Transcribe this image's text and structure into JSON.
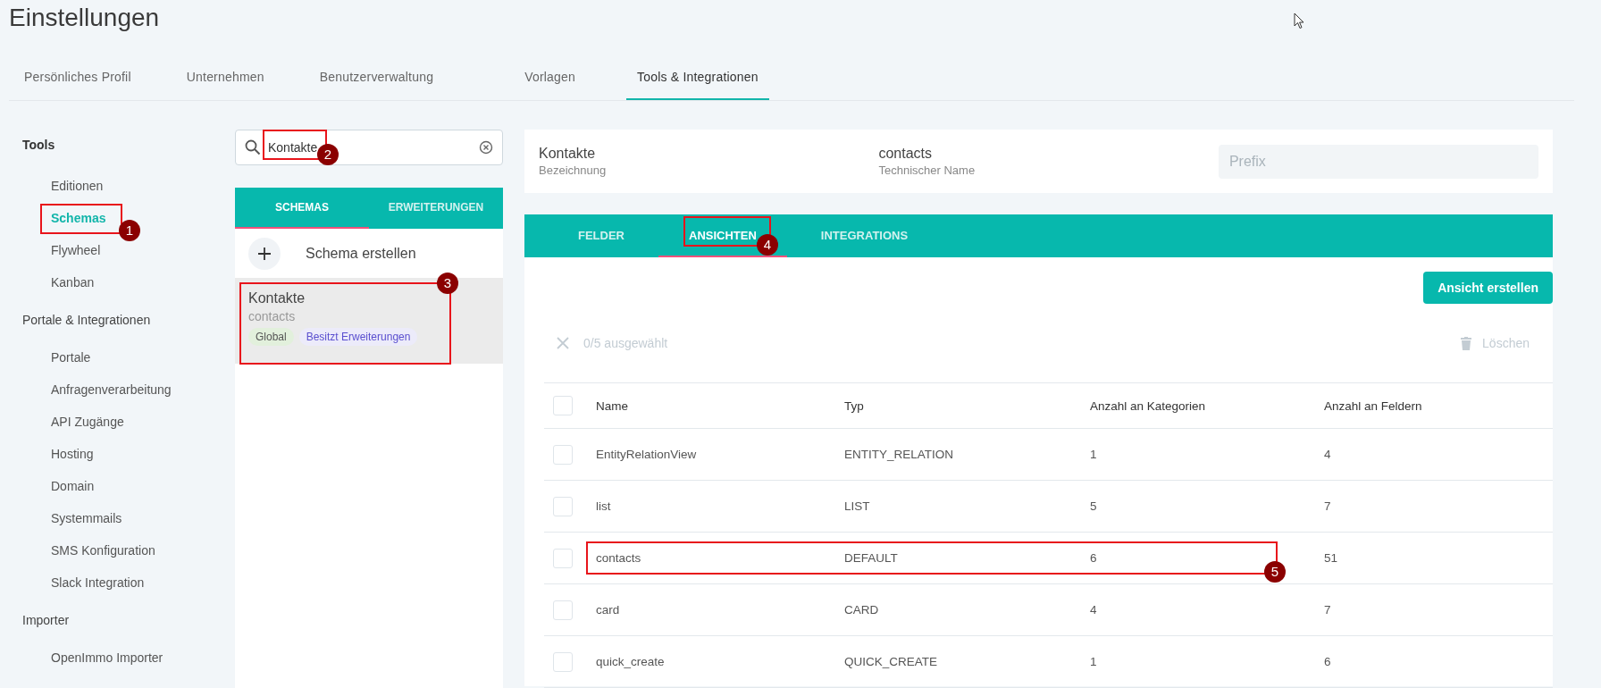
{
  "page_title": "Einstellungen",
  "tabs": [
    {
      "label": "Persönliches Profil",
      "selected": false
    },
    {
      "label": "Unternehmen",
      "selected": false
    },
    {
      "label": "Benutzerverwaltung",
      "selected": false
    },
    {
      "label": "Vorlagen",
      "selected": false
    },
    {
      "label": "Tools & Integrationen",
      "selected": true
    }
  ],
  "sidebar": {
    "sections": [
      {
        "heading": "Tools",
        "active": true,
        "items": [
          {
            "label": "Editionen",
            "selected": false
          },
          {
            "label": "Schemas",
            "selected": true,
            "callout": "1"
          },
          {
            "label": "Flywheel",
            "selected": false
          },
          {
            "label": "Kanban",
            "selected": false
          }
        ]
      },
      {
        "heading": "Portale & Integrationen",
        "active": false,
        "items": [
          {
            "label": "Portale",
            "selected": false
          },
          {
            "label": "Anfragenverarbeitung",
            "selected": false
          },
          {
            "label": "API Zugänge",
            "selected": false
          },
          {
            "label": "Hosting",
            "selected": false
          },
          {
            "label": "Domain",
            "selected": false
          },
          {
            "label": "Systemmails",
            "selected": false
          },
          {
            "label": "SMS Konfiguration",
            "selected": false
          },
          {
            "label": "Slack Integration",
            "selected": false
          }
        ]
      },
      {
        "heading": "Importer",
        "active": false,
        "items": [
          {
            "label": "OpenImmo Importer",
            "selected": false
          }
        ]
      }
    ]
  },
  "search": {
    "value": "Kontakte",
    "callout": "2"
  },
  "schema_tabs": [
    {
      "label": "SCHEMAS",
      "selected": true
    },
    {
      "label": "ERWEITERUNGEN",
      "selected": false
    }
  ],
  "create_schema": {
    "label": "Schema erstellen"
  },
  "schemas": [
    {
      "name": "Kontakte",
      "technical_name": "contacts",
      "selected": true,
      "callout": "3",
      "tags": [
        {
          "label": "Global",
          "color": "#e2f0dc"
        },
        {
          "label": "Besitzt Erweiterungen",
          "color": "#ecebfa"
        }
      ]
    }
  ],
  "detail": {
    "name": "Kontakte",
    "name_caption": "Bezeichnung",
    "technical_name": "contacts",
    "technical_caption": "Technischer Name",
    "prefix": {
      "placeholder": "Prefix"
    }
  },
  "view_tabs": [
    {
      "label": "FELDER",
      "selected": false
    },
    {
      "label": "ANSICHTEN",
      "selected": true,
      "callout": "4"
    },
    {
      "label": "INTEGRATIONS",
      "selected": false
    }
  ],
  "create_view_button": "Ansicht erstellen",
  "selection": {
    "count": "0/5 ausgewählt",
    "delete": "Löschen"
  },
  "table": {
    "all_checked": false,
    "columns": [
      "Name",
      "Typ",
      "Anzahl an Kategorien",
      "Anzahl an Feldern"
    ],
    "rows": [
      {
        "checked": false,
        "cells": [
          "EntityRelationView",
          "ENTITY_RELATION",
          "1",
          "4"
        ]
      },
      {
        "checked": false,
        "cells": [
          "list",
          "LIST",
          "5",
          "7"
        ]
      },
      {
        "checked": false,
        "cells": [
          "contacts",
          "DEFAULT",
          "6",
          "51"
        ],
        "callout": "5"
      },
      {
        "checked": false,
        "cells": [
          "card",
          "CARD",
          "4",
          "7"
        ]
      },
      {
        "checked": false,
        "cells": [
          "quick_create",
          "QUICK_CREATE",
          "1",
          "6"
        ]
      }
    ]
  }
}
